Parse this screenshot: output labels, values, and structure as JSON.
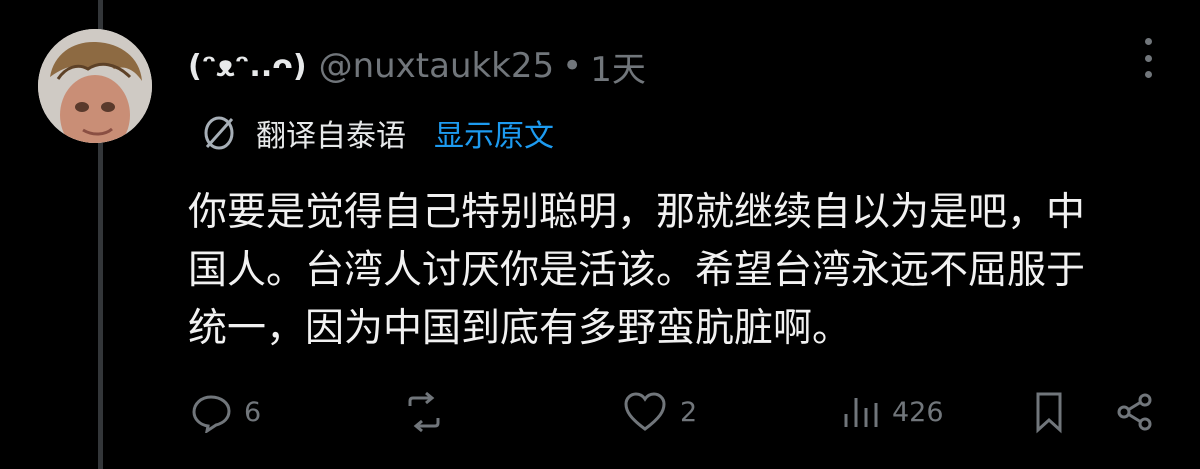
{
  "post": {
    "display_name": "(ᵔᴥᵔ..ᴖ)",
    "handle": "@nuxtaukk25",
    "separator": "•",
    "timestamp": "1天",
    "translation_label": "翻译自泰语",
    "show_original_label": "显示原文",
    "body": "你要是觉得自己特别聪明，那就继续自以为是吧，中\n国人。台湾人讨厌你是活该。希望台湾永远不屈服于\n统一，因为中国到底有多野蛮肮脏啊。"
  },
  "actions": {
    "reply_count": "6",
    "like_count": "2",
    "views_count": "426"
  },
  "icons": {
    "more": "more-icon",
    "translate": "translate-icon",
    "reply": "reply-icon",
    "repost": "repost-icon",
    "like": "heart-icon",
    "views": "views-icon",
    "bookmark": "bookmark-icon",
    "share": "share-icon"
  },
  "colors": {
    "background": "#000000",
    "text": "#e7e9ea",
    "muted": "#71767b",
    "link": "#1d9bf0"
  }
}
